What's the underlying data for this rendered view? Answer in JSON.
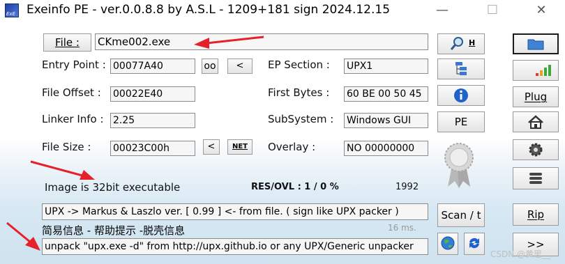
{
  "window": {
    "title": "Exeinfo PE - ver.0.0.8.8  by A.S.L -  1209+181 sign  2024.12.15",
    "icon_text": "ExE",
    "minimize": "—",
    "maximize": "☐",
    "close": "✕"
  },
  "file": {
    "button_label": "File :",
    "path": "CKme002.exe"
  },
  "fields": {
    "entry_point_label": "Entry Point :",
    "entry_point": "00077A40",
    "oo_label": "oo",
    "lt_label": "<",
    "ep_section_label": "EP Section :",
    "ep_section": "UPX1",
    "file_offset_label": "File Offset :",
    "file_offset": "00022E40",
    "first_bytes_label": "First Bytes :",
    "first_bytes": "60 BE 00 50 45",
    "linker_info_label": "Linker Info :",
    "linker_info": "2.25",
    "subsystem_label": "SubSystem :",
    "subsystem": "Windows GUI",
    "file_size_label": "File Size :",
    "file_size": "00023C00h",
    "size_lt_label": "<",
    "net_label": "NET",
    "overlay_label": "Overlay :",
    "overlay": "NO   00000000"
  },
  "status": {
    "image_text": "Image is 32bit executable",
    "res_ovl": "RES/OVL : 1 / 0 %",
    "year": "1992",
    "detection": "UPX -> Markus & Laszlo ver. [ 0.99 ] <- from file. ( sign like UPX packer )",
    "time": "16 ms.",
    "chinese_info": "简易信息 - 帮助提示 -脱壳信息",
    "hint": "unpack \"upx.exe -d\"  from  http://upx.github.io or any UPX/Generic unpacker"
  },
  "buttons": {
    "search_h": "H",
    "pe": "PE",
    "scan": "Scan / t",
    "plug": "Plug",
    "rip": "Rip",
    "more": ">>"
  },
  "watermark": "CSDN @黄思__",
  "colors": {
    "arrow": "#e5212a",
    "accent_blue": "#1f62c9"
  }
}
